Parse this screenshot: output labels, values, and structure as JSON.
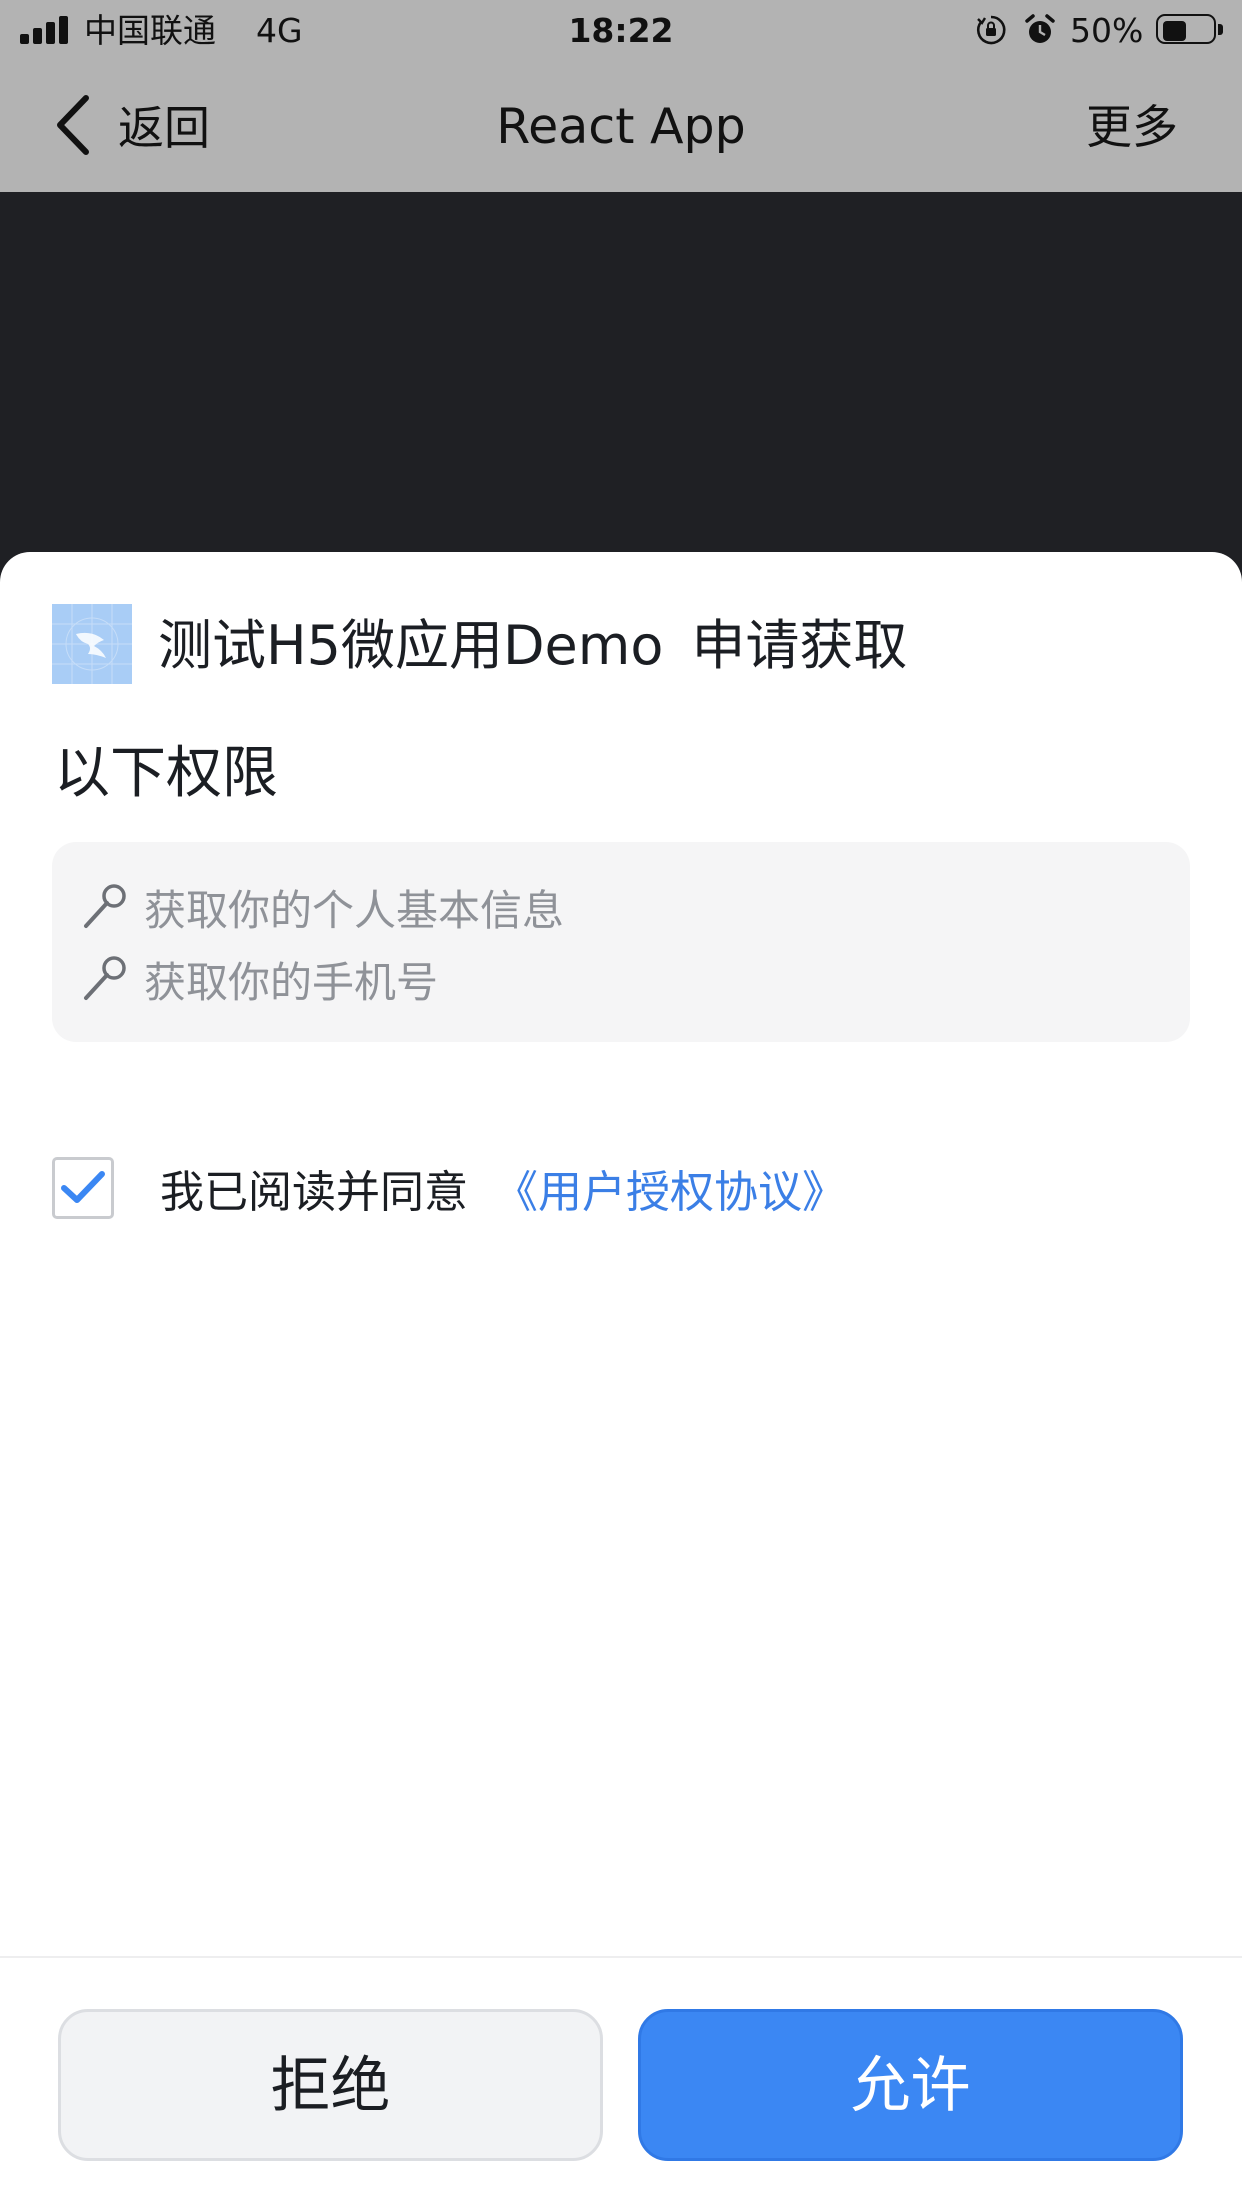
{
  "status_bar": {
    "carrier": "中国联通",
    "network": "4G",
    "time": "18:22",
    "battery_percent": "50%",
    "battery_level": 0.5,
    "icons": [
      "signal-icon",
      "orientation-lock-icon",
      "alarm-icon",
      "battery-icon"
    ]
  },
  "nav": {
    "back_label": "返回",
    "title": "React App",
    "more_label": "更多"
  },
  "dialog": {
    "app_name": "测试H5微应用Demo",
    "request_suffix": "申请获取",
    "heading": "以下权限",
    "permissions": [
      {
        "icon": "key-icon",
        "label": "获取你的个人基本信息"
      },
      {
        "icon": "key-icon",
        "label": "获取你的手机号"
      }
    ],
    "agree_checked": true,
    "agree_text": "我已阅读并同意",
    "agreement_link": "《用户授权协议》",
    "reject_label": "拒绝",
    "allow_label": "允许"
  },
  "colors": {
    "bars": "#b3b3b3",
    "backdrop": "#1f2024",
    "accent": "#3b87f3",
    "link": "#3b7fe6",
    "muted_text": "#8f9298"
  }
}
